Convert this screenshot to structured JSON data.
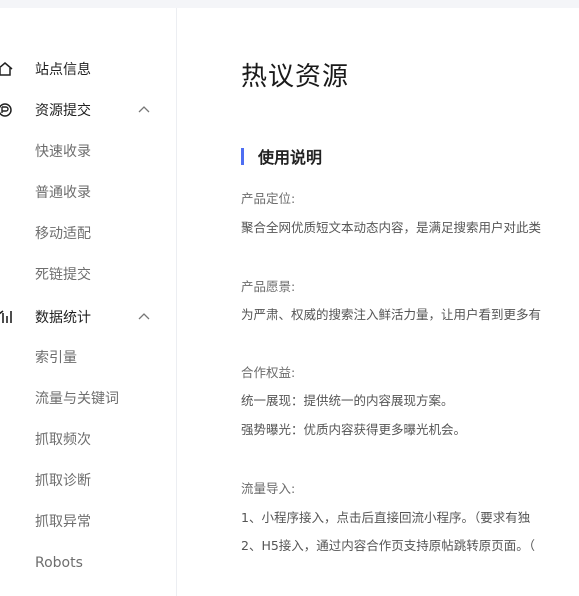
{
  "sidebar": {
    "items": [
      {
        "label": "站点信息",
        "icon": "home-icon"
      },
      {
        "label": "资源提交",
        "icon": "resource-submit-icon",
        "expanded": true
      },
      {
        "label": "快速收录"
      },
      {
        "label": "普通收录"
      },
      {
        "label": "移动适配"
      },
      {
        "label": "死链提交"
      },
      {
        "label": "数据统计",
        "icon": "statistics-icon",
        "expanded": true
      },
      {
        "label": "索引量"
      },
      {
        "label": "流量与关键词"
      },
      {
        "label": "抓取频次"
      },
      {
        "label": "抓取诊断"
      },
      {
        "label": "抓取异常"
      },
      {
        "label": "Robots"
      }
    ]
  },
  "main": {
    "title": "热议资源",
    "section_title": "使用说明",
    "lines": {
      "positioning_label": "产品定位:",
      "positioning_text": "聚合全网优质短文本动态内容，是满足搜索用户对此类",
      "vision_label": "产品愿景:",
      "vision_text": "为严肃、权威的搜索注入鲜活力量，让用户看到更多有",
      "benefits_label": "合作权益:",
      "benefit_1": "统一展现：提供统一的内容展现方案。",
      "benefit_2": "强势曝光：优质内容获得更多曝光机会。",
      "traffic_label": "流量导入:",
      "traffic_1": "1、小程序接入，点击后直接回流小程序。（要求有独",
      "traffic_2": "2、H5接入，通过内容合作页支持原帖跳转原页面。（"
    }
  },
  "colors": {
    "accent": "#4e6ef2",
    "divider": "#eceef2",
    "topbar": "#f4f5f8"
  }
}
